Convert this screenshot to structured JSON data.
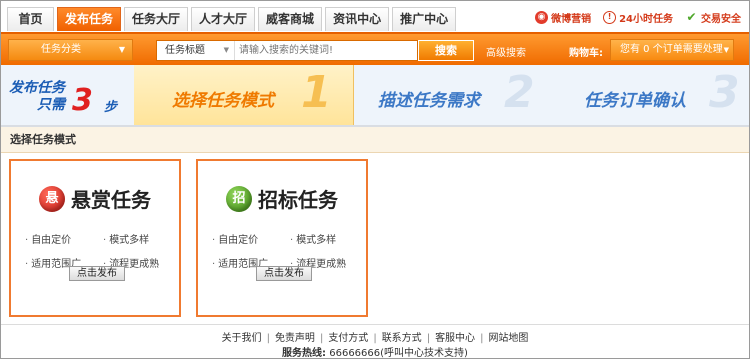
{
  "nav": {
    "tabs": [
      "首页",
      "发布任务",
      "任务大厅",
      "人才大厅",
      "威客商城",
      "资讯中心",
      "推广中心"
    ],
    "active_tab": "发布任务",
    "links": [
      {
        "icon": "weibo-icon",
        "label": "微博营销"
      },
      {
        "icon": "clock-icon",
        "label": "24小时任务"
      },
      {
        "icon": "shield-check-icon",
        "label": "交易安全"
      }
    ]
  },
  "search": {
    "category_label": "任务分类",
    "type_label": "任务标题",
    "placeholder": "请输入搜索的关键词!",
    "button": "搜索",
    "advanced": "高级搜索",
    "cart_label": "购物车:",
    "cart_text": "您有 0 个订单需要处理"
  },
  "steps": {
    "slogan_line1": "发布任务",
    "slogan_line2": "只需",
    "slogan_num": "3",
    "slogan_unit": "步",
    "items": [
      {
        "label": "选择任务模式",
        "num": "1"
      },
      {
        "label": "描述任务需求",
        "num": "2"
      },
      {
        "label": "任务订单确认",
        "num": "3"
      }
    ]
  },
  "section_title": "选择任务模式",
  "modes": [
    {
      "badge": "悬",
      "title": "悬赏任务",
      "features": [
        "自由定价",
        "模式多样",
        "适用范围广",
        "流程更成熟"
      ],
      "button": "点击发布"
    },
    {
      "badge": "招",
      "title": "招标任务",
      "features": [
        "自由定价",
        "模式多样",
        "适用范围广",
        "流程更成熟"
      ],
      "button": "点击发布"
    }
  ],
  "footer": {
    "links": [
      "关于我们",
      "免责声明",
      "支付方式",
      "联系方式",
      "客服中心",
      "网站地图"
    ],
    "hotline_label": "服务热线:",
    "hotline_number": "66666666",
    "hotline_note": "(呼叫中心技术支持)"
  },
  "colors": {
    "accent": "#f06b00",
    "step_active": "#ef7a00",
    "step_inactive": "#3c78c6",
    "card_border": "#f07a30"
  }
}
